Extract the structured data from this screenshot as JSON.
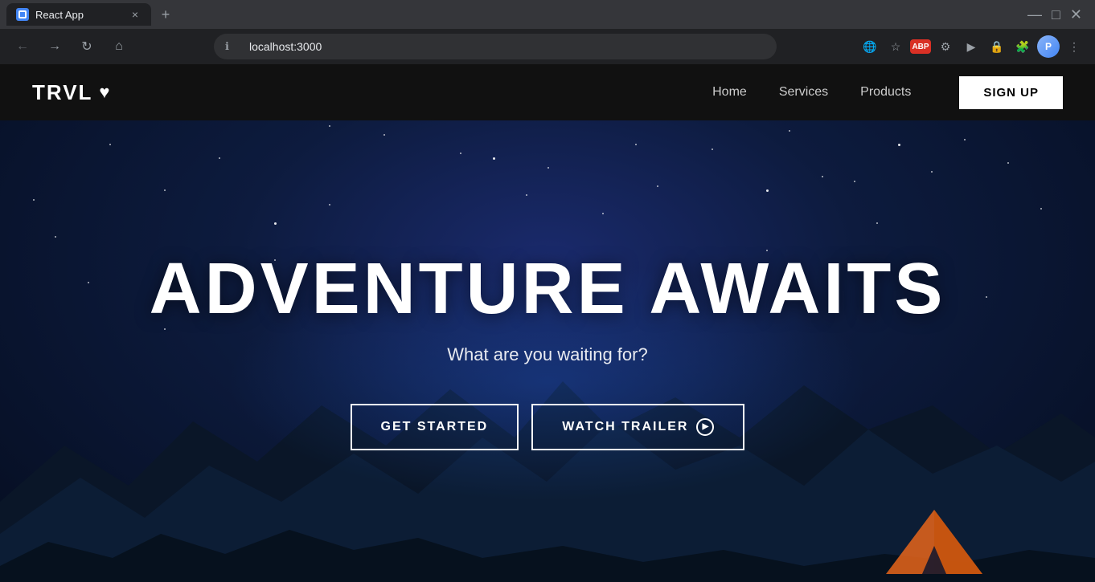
{
  "browser": {
    "tab_title": "React App",
    "url": "localhost:3000",
    "new_tab_icon": "+",
    "close_icon": "×"
  },
  "navbar": {
    "brand": "TRVL",
    "brand_icon": "♥",
    "home_label": "Home",
    "services_label": "Services",
    "products_label": "Products",
    "signup_label": "SIGN UP"
  },
  "hero": {
    "title": "ADVENTURE AWAITS",
    "subtitle": "What are you waiting for?",
    "cta_primary": "GET STARTED",
    "cta_secondary": "WATCH TRAILER"
  }
}
